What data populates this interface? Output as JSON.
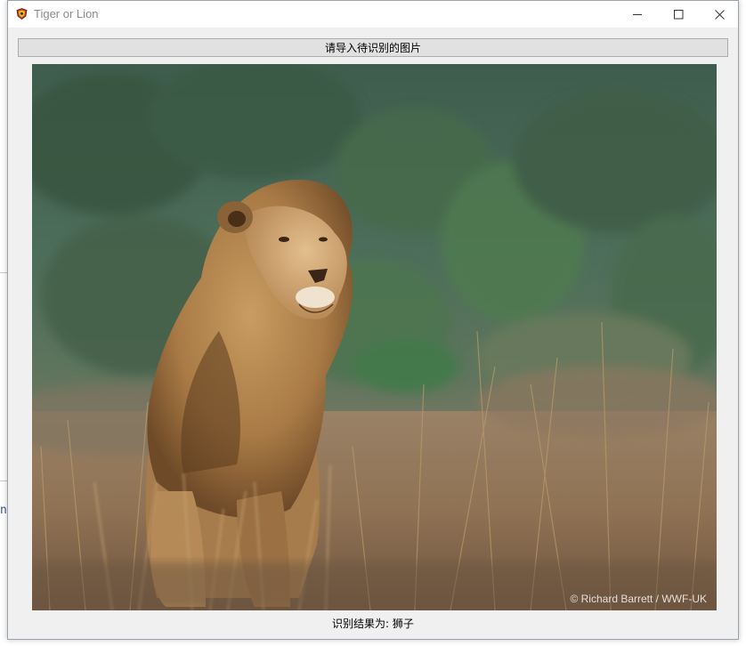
{
  "window": {
    "title": "Tiger or Lion",
    "icon": "app-shield-icon"
  },
  "titlebar_buttons": {
    "minimize": "minimize-icon",
    "maximize": "maximize-icon",
    "close": "close-icon"
  },
  "main": {
    "import_button_label": "请导入待识别的图片",
    "image_description": "lion-photo",
    "image_watermark": "© Richard Barrett / WWF-UK",
    "result_label": "识别结果为:",
    "result_value": "狮子"
  },
  "background_app": {
    "fragment": "n"
  }
}
